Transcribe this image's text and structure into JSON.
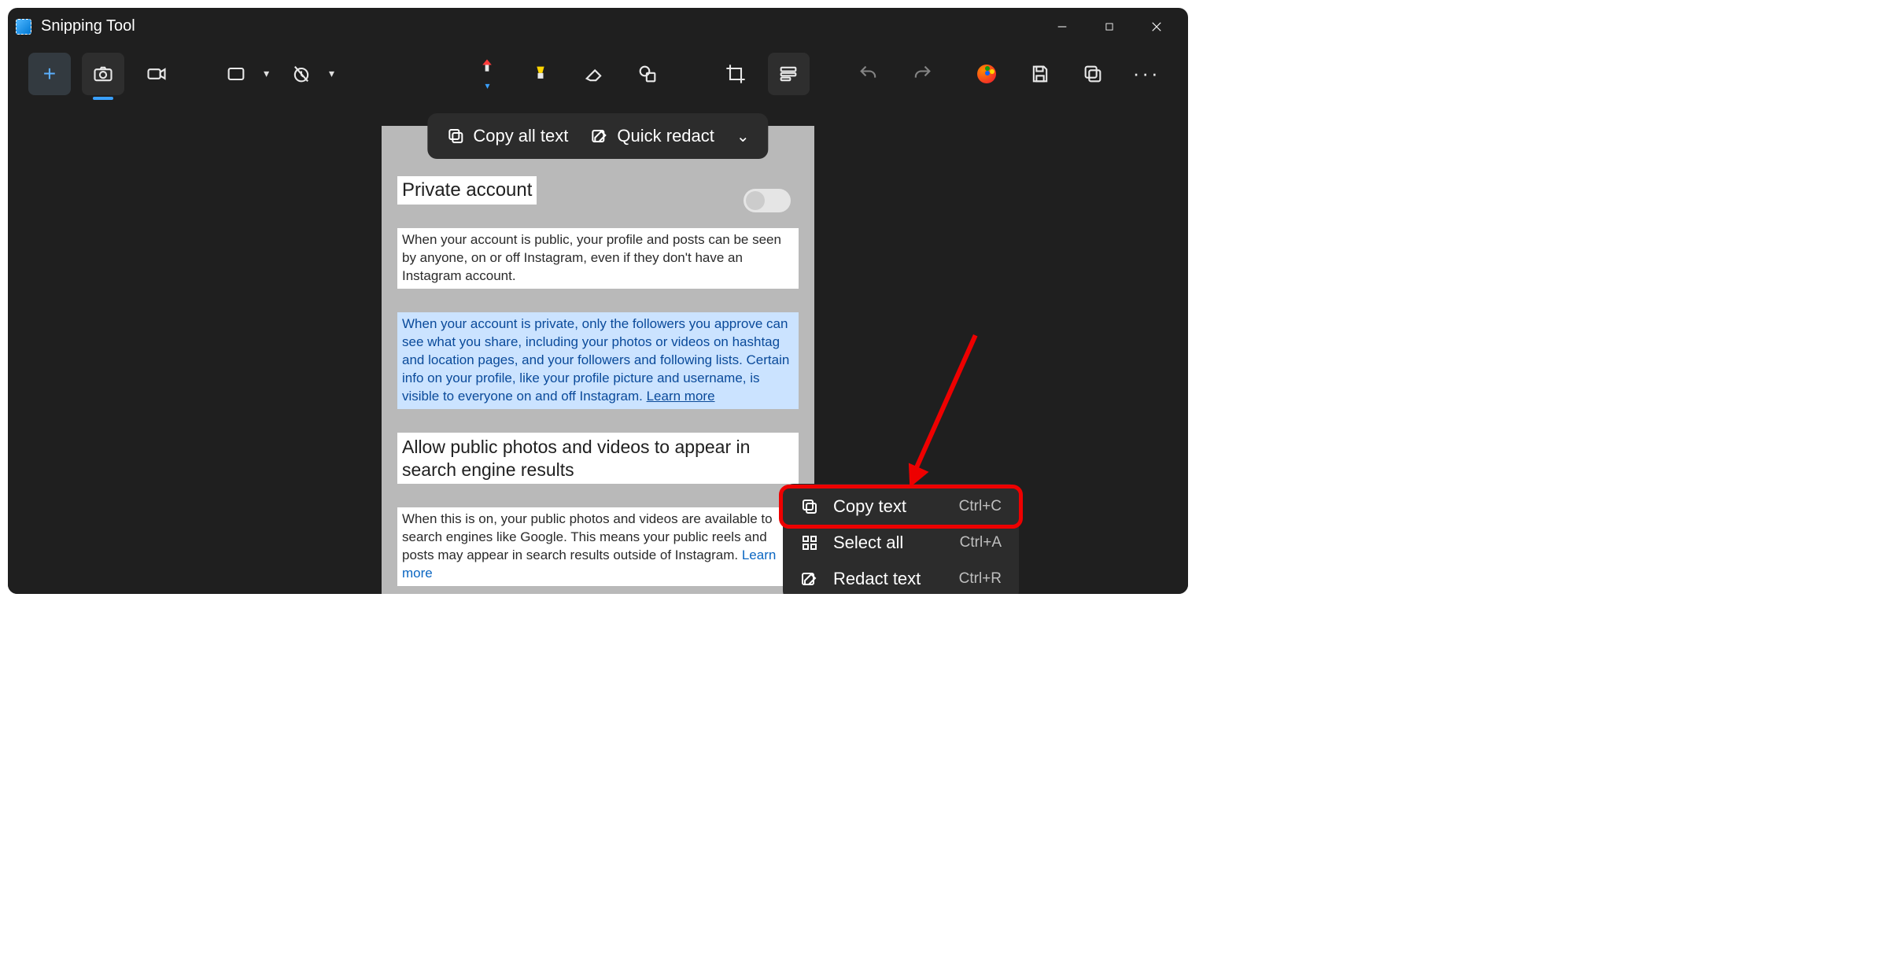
{
  "titlebar": {
    "title": "Snipping Tool"
  },
  "floatbar": {
    "copy_all": "Copy all text",
    "quick_redact": "Quick redact"
  },
  "snip": {
    "heading1": "Private account",
    "para1": "When your account is public, your profile and posts can be seen by anyone, on or off Instagram, even if they don't have an Instagram account.",
    "para2": "When your account is private, only the followers you approve can see what you share, including your photos or videos on hashtag and location pages, and your followers and following lists. Certain info on your profile, like your profile picture and username, is visible to everyone on and off Instagram. ",
    "learn_more1": "Learn more",
    "heading2": "Allow public photos and videos to appear in search engine results",
    "para3": "When this is on, your public photos and videos are available to search engines like Google. This means your public reels and posts may appear in search results outside of Instagram. ",
    "learn_more2": "Learn more"
  },
  "context_menu": {
    "items": [
      {
        "label": "Copy text",
        "shortcut": "Ctrl+C",
        "icon": "copy"
      },
      {
        "label": "Select all",
        "shortcut": "Ctrl+A",
        "icon": "select"
      },
      {
        "label": "Redact text",
        "shortcut": "Ctrl+R",
        "icon": "redact"
      }
    ]
  },
  "annotation": {
    "highlight_index": 0,
    "highlight_color": "#e00000"
  }
}
